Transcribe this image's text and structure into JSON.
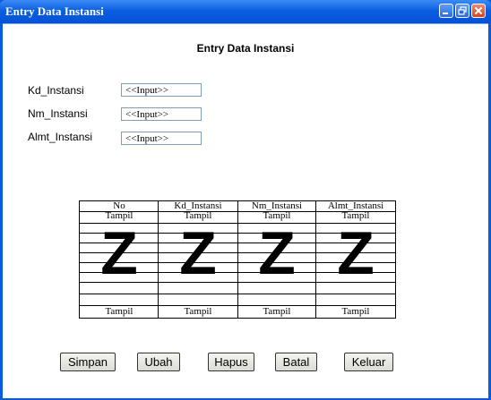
{
  "window": {
    "title": "Entry Data Instansi",
    "controls": [
      "minimize-icon",
      "restore-icon",
      "close-icon"
    ]
  },
  "form": {
    "heading": "Entry Data Instansi",
    "fields": [
      {
        "label": "Kd_Instansi",
        "value": "<<Input>>"
      },
      {
        "label": "Nm_Instansi",
        "value": "<<Input>>"
      },
      {
        "label": "Almt_Instansi",
        "value": "<<Input>>"
      }
    ]
  },
  "table": {
    "columns": [
      "No",
      "Kd_Instansi",
      "Nm_Instansi",
      "Almt_Instansi"
    ],
    "top_row": [
      "Tampil",
      "Tampil",
      "Tampil",
      "Tampil"
    ],
    "bottom_row": [
      "Tampil",
      "Tampil",
      "Tampil",
      "Tampil"
    ],
    "placeholder_marks": [
      "Z",
      "Z",
      "Z",
      "Z"
    ]
  },
  "buttons": [
    "Simpan",
    "Ubah",
    "Hapus",
    "Batal",
    "Keluar"
  ]
}
